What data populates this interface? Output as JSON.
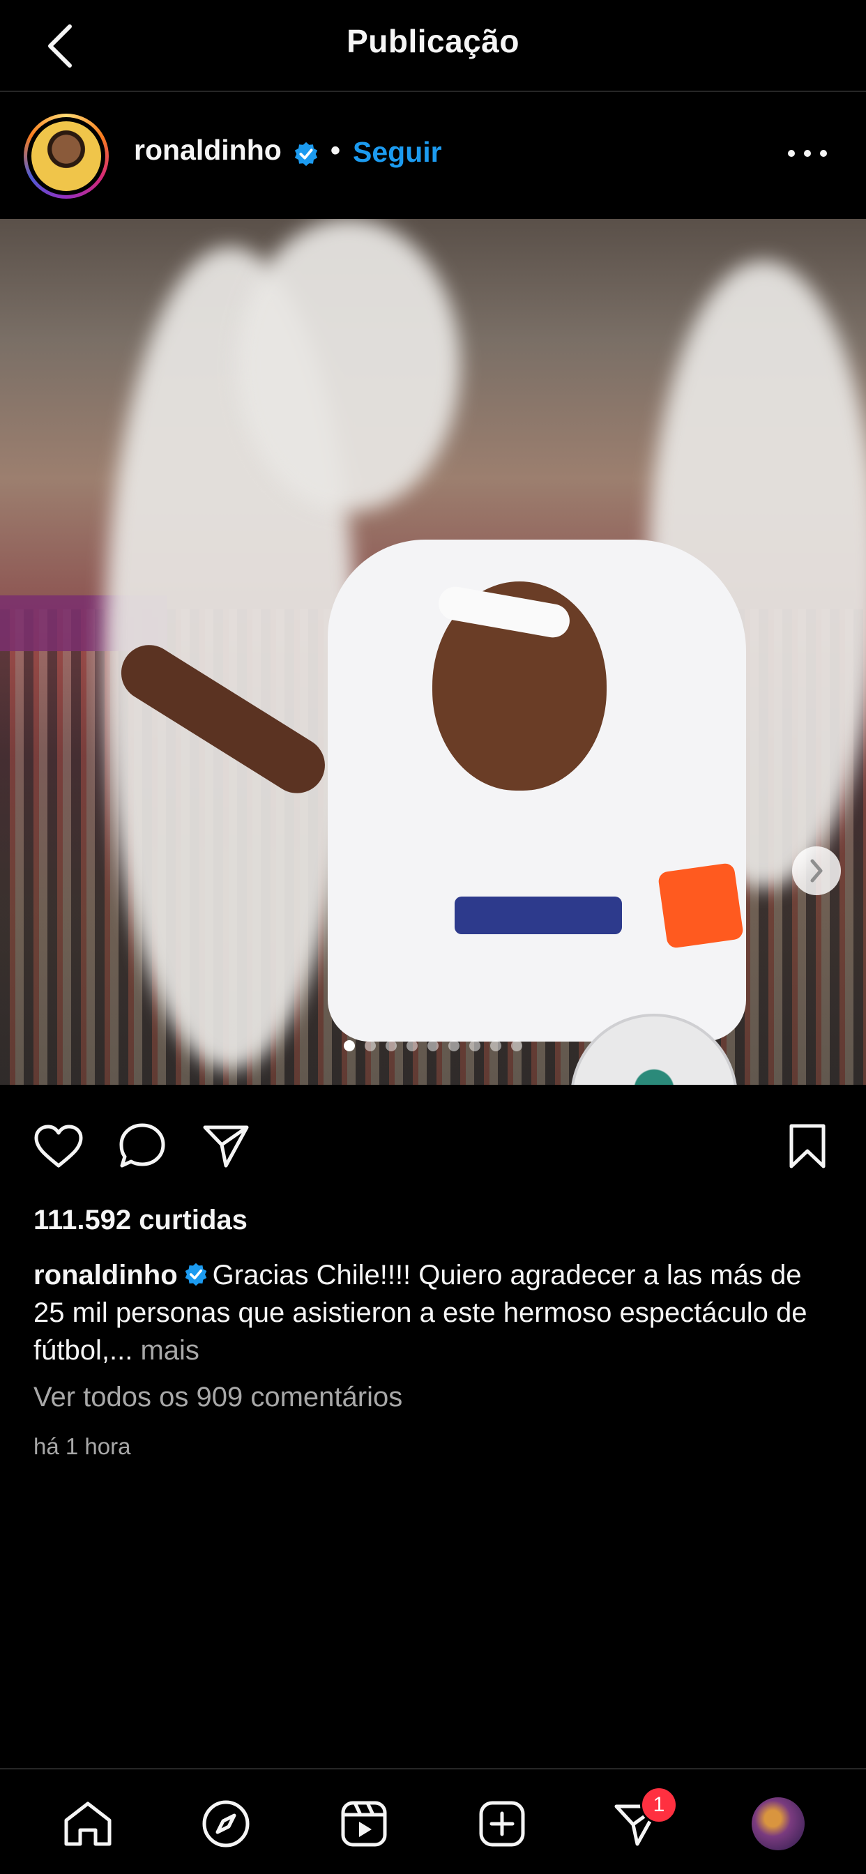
{
  "header": {
    "title": "Publicação",
    "back_icon": "chevron-left-icon"
  },
  "post": {
    "username": "ronaldinho",
    "verified": true,
    "separator": "•",
    "follow_label": "Seguir",
    "more_icon": "ellipsis-icon",
    "carousel": {
      "total": 9,
      "current": 1,
      "next_icon": "chevron-right-icon"
    },
    "actions": {
      "like_icon": "heart-icon",
      "comment_icon": "comment-icon",
      "share_icon": "send-icon",
      "save_icon": "bookmark-icon"
    },
    "likes_text": "111.592 curtidas",
    "caption": {
      "user": "ronaldinho",
      "text": "Gracias Chile!!!! Quiero agradecer a las más de 25 mil personas que asistieron a este hermoso espectáculo de fútbol,...",
      "more_label": "mais"
    },
    "comments_link": "Ver todos os 909 comentários",
    "timestamp": "há 1 hora"
  },
  "bottom_nav": {
    "items": [
      "home-icon",
      "explore-icon",
      "reels-icon",
      "create-icon",
      "activity-icon",
      "profile-avatar"
    ],
    "badge_count": "1"
  },
  "colors": {
    "accent": "#1c9bf0",
    "badge": "#ff3040",
    "background": "#000000",
    "muted": "#a8a8a8"
  }
}
